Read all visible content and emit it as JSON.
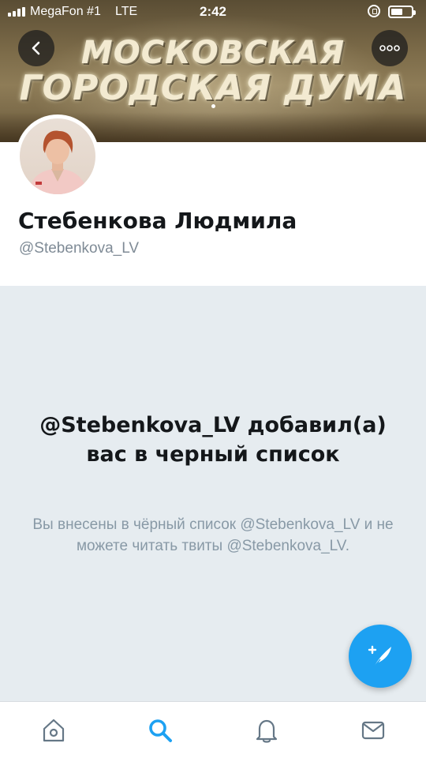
{
  "status_bar": {
    "carrier": "MegaFon #1",
    "network": "LTE",
    "time": "2:42"
  },
  "banner": {
    "line1": "МОСКОВСКАЯ",
    "line2": "ГОРОДСКАЯ ДУМА"
  },
  "profile": {
    "name": "Стебенкова Людмила",
    "handle": "@Stebenkova_LV"
  },
  "blocked": {
    "title": "@Stebenkova_LV добавил(а) вас в черный список",
    "body": "Вы внесены в чёрный список @Stebenkova_LV и не можете читать твиты @Stebenkova_LV."
  },
  "tabs": [
    {
      "icon": "home-icon",
      "active": false
    },
    {
      "icon": "search-icon",
      "active": true
    },
    {
      "icon": "notifications-bell-icon",
      "active": false
    },
    {
      "icon": "messages-envelope-icon",
      "active": false
    }
  ],
  "colors": {
    "accent": "#1da1f2",
    "background_blocked": "#e6ecf0",
    "text_primary": "#14171a",
    "text_secondary": "#8899a6"
  }
}
